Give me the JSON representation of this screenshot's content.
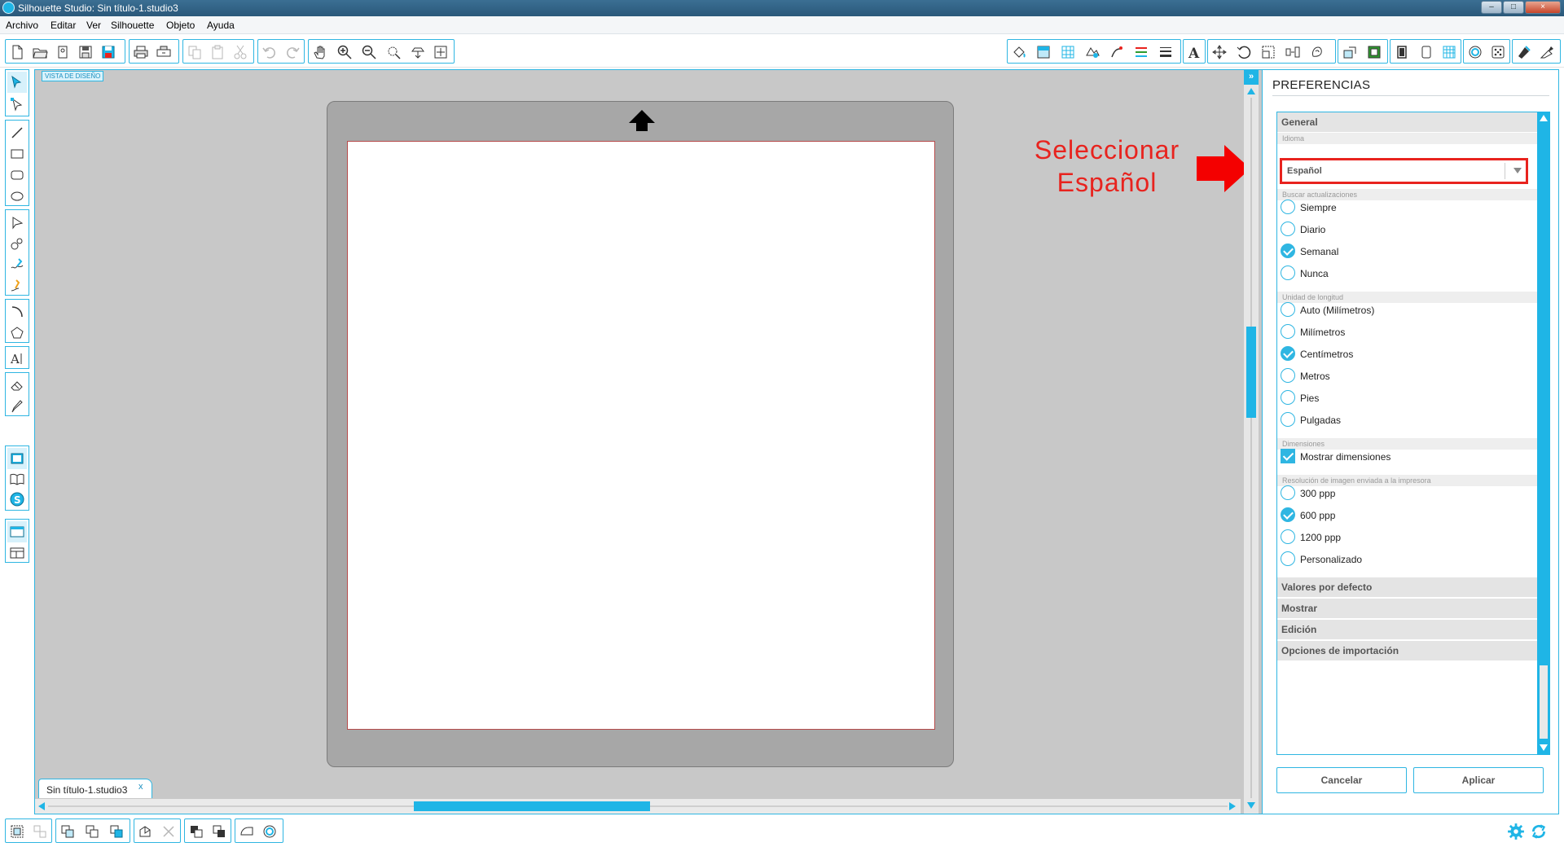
{
  "window": {
    "title": "Silhouette Studio: Sin título-1.studio3",
    "minimize_label": "–",
    "maximize_label": "□",
    "close_label": "×"
  },
  "menu": [
    "Archivo",
    "Editar",
    "Ver",
    "Silhouette",
    "Objeto",
    "Ayuda"
  ],
  "toolbar_icons": {
    "file": [
      "new-document-icon",
      "open-folder-icon",
      "open-library-icon",
      "save-icon",
      "save-to-library-icon"
    ],
    "print": [
      "print-icon",
      "send-to-silhouette-icon"
    ],
    "clipboard": [
      "copy-icon",
      "paste-icon",
      "cut-icon"
    ],
    "history": [
      "undo-icon",
      "redo-icon"
    ],
    "view": [
      "pan-hand-icon",
      "zoom-in-icon",
      "zoom-out-icon",
      "zoom-select-icon",
      "drag-zoom-icon",
      "fit-to-page-icon"
    ],
    "right_panels": [
      "fill-color-icon",
      "fill-gradient-icon",
      "fill-pattern-icon",
      "line-color-icon",
      "line-style-icon",
      "align-icon",
      "line-thickness-icon",
      "text-style-icon",
      "transform-icon",
      "rotate-icon",
      "scale-icon",
      "move-icon",
      "replicate-icon",
      "modify-icon",
      "offset-icon",
      "trace-icon",
      "page-setup-icon",
      "cut-settings-icon",
      "library-icon",
      "store-icon",
      "grid-icon",
      "send-icon",
      "preferences-icon"
    ]
  },
  "left_tools": [
    "select-tool-icon",
    "point-edit-tool-icon",
    "line-tool-icon",
    "rectangle-tool-icon",
    "rounded-rectangle-tool-icon",
    "ellipse-tool-icon",
    "polygon-tool-icon",
    "curve-tool-icon",
    "freehand-tool-icon",
    "smooth-freehand-tool-icon",
    "arc-tool-icon",
    "regular-polygon-tool-icon",
    "text-tool-icon",
    "eraser-tool-icon",
    "knife-tool-icon",
    "design-view-icon",
    "library-view-icon",
    "online-store-icon",
    "single-panel-icon",
    "split-panel-icon"
  ],
  "canvas": {
    "view_label": "VISTA DE DISEÑO",
    "collapse_label": "»",
    "annotation": [
      "Seleccionar",
      "Español"
    ],
    "annotation_color": "#e8231e"
  },
  "document_tab": {
    "label": "Sin título-1.studio3",
    "close_label": "x"
  },
  "preferences": {
    "title": "PREFERENCIAS",
    "general_header": "General",
    "language_label": "Idioma",
    "language_value": "Español",
    "updates_label": "Buscar actualizaciones",
    "updates_options": [
      {
        "label": "Siempre",
        "checked": false
      },
      {
        "label": "Diario",
        "checked": false
      },
      {
        "label": "Semanal",
        "checked": true
      },
      {
        "label": "Nunca",
        "checked": false
      }
    ],
    "units_label": "Unidad de longitud",
    "units_options": [
      {
        "label": "Auto (Milímetros)",
        "checked": false
      },
      {
        "label": "Milímetros",
        "checked": false
      },
      {
        "label": "Centímetros",
        "checked": true
      },
      {
        "label": "Metros",
        "checked": false
      },
      {
        "label": "Pies",
        "checked": false
      },
      {
        "label": "Pulgadas",
        "checked": false
      }
    ],
    "dimensions_label": "Dimensiones",
    "show_dimensions": {
      "label": "Mostrar dimensiones",
      "checked": true
    },
    "resolution_label": "Resolución de imagen enviada a la impresora",
    "resolution_options": [
      {
        "label": "300 ppp",
        "checked": false
      },
      {
        "label": "600 ppp",
        "checked": true
      },
      {
        "label": "1200 ppp",
        "checked": false
      },
      {
        "label": "Personalizado",
        "checked": false
      }
    ],
    "sections": [
      "Valores por defecto",
      "Mostrar",
      "Edición",
      "Opciones de importación"
    ],
    "cancel_label": "Cancelar",
    "apply_label": "Aplicar"
  },
  "bottom_icons": [
    "group-icon",
    "ungroup-icon",
    "compound-path-icon",
    "release-compound-icon",
    "bring-to-front-icon",
    "send-to-back-icon",
    "weld-icon",
    "duplicate-icon",
    "delete-icon",
    "bring-forward-icon",
    "send-backward-icon",
    "select-all-icon",
    "offset-icon"
  ],
  "status_icons": [
    "settings-gear-icon",
    "sync-icon"
  ],
  "colors": {
    "accent": "#1fb5e6",
    "mat": "#a7a7a7",
    "canvas_bg": "#c8c8c8",
    "highlight": "#e8231e"
  }
}
